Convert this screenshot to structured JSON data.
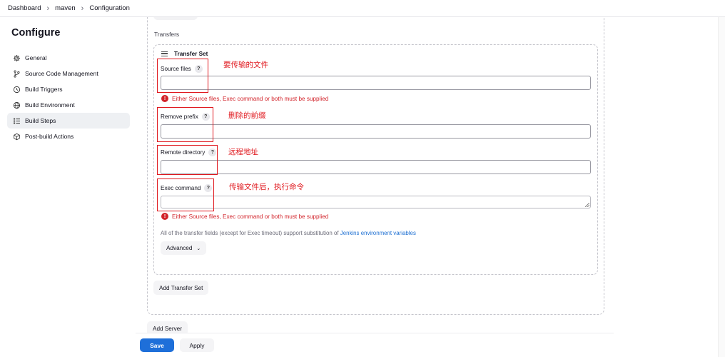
{
  "breadcrumb": [
    "Dashboard",
    "maven",
    "Configuration"
  ],
  "sidebar": {
    "title": "Configure",
    "items": [
      {
        "label": "General",
        "icon": "gear-icon"
      },
      {
        "label": "Source Code Management",
        "icon": "branch-icon"
      },
      {
        "label": "Build Triggers",
        "icon": "clock-icon"
      },
      {
        "label": "Build Environment",
        "icon": "globe-icon"
      },
      {
        "label": "Build Steps",
        "icon": "list-icon",
        "active": true
      },
      {
        "label": "Post-build Actions",
        "icon": "cube-icon"
      }
    ]
  },
  "transfers": {
    "label": "Transfers",
    "set_title": "Transfer Set",
    "fields": {
      "source_files": {
        "label": "Source files",
        "value": ""
      },
      "remove_prefix": {
        "label": "Remove prefix",
        "value": ""
      },
      "remote_directory": {
        "label": "Remote directory",
        "value": ""
      },
      "exec_command": {
        "label": "Exec command",
        "value": ""
      }
    },
    "error": "Either Source files, Exec command or both must be supplied",
    "note_prefix": "All of the transfer fields (except for Exec timeout) support substitution of ",
    "note_link": "Jenkins environment variables",
    "advanced_label": "Advanced",
    "add_transfer_set_label": "Add Transfer Set",
    "help_glyph": "?"
  },
  "add_server_label": "Add Server",
  "annotations": {
    "source_files": "要传输的文件",
    "remove_prefix": "删除的前缀",
    "remote_directory": "远程地址",
    "exec_command": "传输文件后，执行命令"
  },
  "footer": {
    "save_label": "Save",
    "apply_label": "Apply"
  },
  "colors": {
    "accent": "#1e6fd9",
    "error": "#d2232a",
    "annotation": "#e0191f"
  }
}
